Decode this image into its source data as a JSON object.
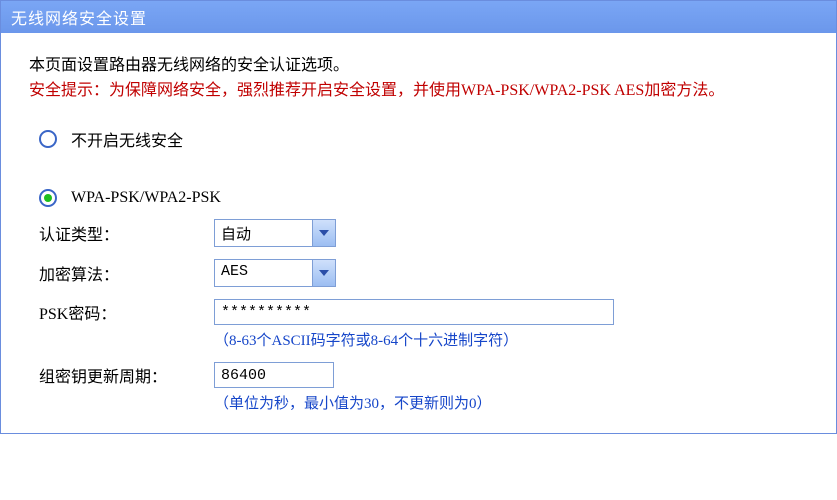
{
  "title": "无线网络安全设置",
  "intro": "本页面设置路由器无线网络的安全认证选项。",
  "warning": "安全提示：为保障网络安全，强烈推荐开启安全设置，并使用WPA-PSK/WPA2-PSK AES加密方法。",
  "option_disable": "不开启无线安全",
  "option_wpa": "WPA-PSK/WPA2-PSK",
  "selected_option": "wpa",
  "labels": {
    "auth_type": "认证类型：",
    "cipher": "加密算法：",
    "psk": "PSK密码：",
    "rekey": "组密钥更新周期："
  },
  "values": {
    "auth_type": "自动",
    "cipher": "AES",
    "psk": "**********",
    "rekey": "86400"
  },
  "hints": {
    "psk": "（8-63个ASCII码字符或8-64个十六进制字符）",
    "rekey": "（单位为秒，最小值为30，不更新则为0）"
  },
  "widths": {
    "psk_input": "400px",
    "rekey_input": "120px"
  }
}
